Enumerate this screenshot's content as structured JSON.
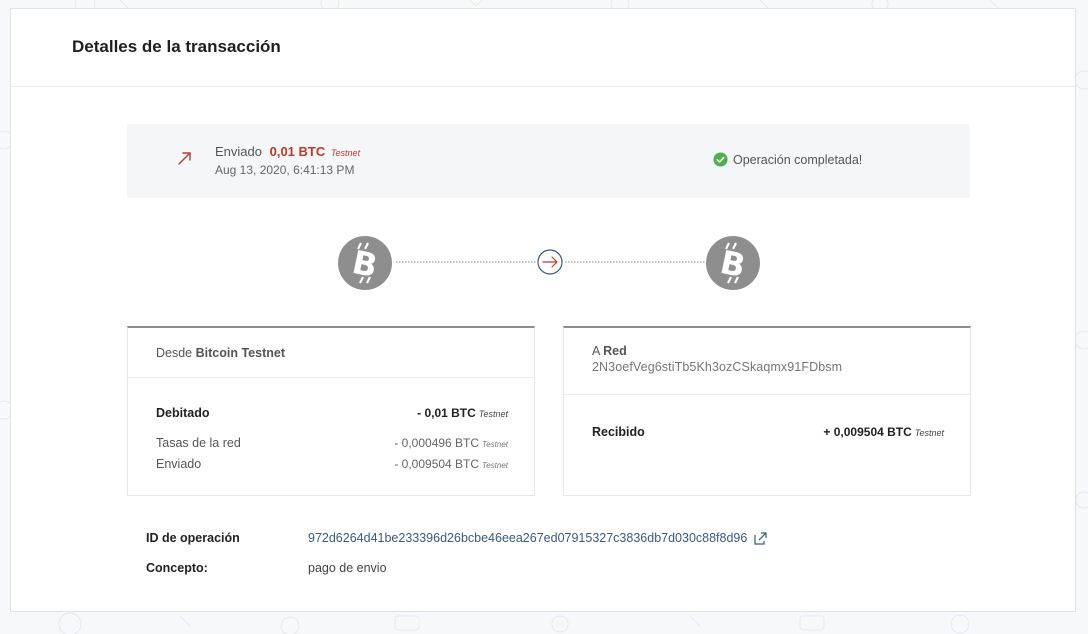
{
  "panel": {
    "title": "Detalles de la transacción"
  },
  "summary": {
    "direction": "Enviado",
    "amount": "0,01 BTC",
    "network": "Testnet",
    "date": "Aug 13, 2020, 6:41:13 PM",
    "status": "Operación completada!"
  },
  "from_card": {
    "prefix": "Desde",
    "name": "Bitcoin Testnet",
    "rows": [
      {
        "label": "Debitado",
        "value": "- 0,01 BTC",
        "net": "Testnet"
      },
      {
        "label": "Tasas de la red",
        "value": "- 0,000496 BTC",
        "net": "Testnet"
      },
      {
        "label": "Enviado",
        "value": "- 0,009504 BTC",
        "net": "Testnet"
      }
    ]
  },
  "to_card": {
    "prefix": "A",
    "name": "Red",
    "address": "2N3oefVeg6stiTb5Kh3ozCSkaqmx91FDbsm",
    "rows": [
      {
        "label": "Recibido",
        "value": "+ 0,009504 BTC",
        "net": "Testnet"
      }
    ]
  },
  "details": {
    "id_label": "ID de operación",
    "id_value": "972d6264d41be233396d26bcbe46eea267ed07915327c3836db7d030c88f8d96",
    "concept_label": "Concepto:",
    "concept_value": "pago de envio"
  },
  "colors": {
    "sent": "#c0392b",
    "success": "#4caf50",
    "bitcoin_badge": "#8e8e8e",
    "link": "#3d5a80"
  },
  "icons": {
    "sent": "arrow-up-right-icon",
    "status": "check-circle-icon",
    "coin": "bitcoin-icon",
    "transfer": "arrow-right-circle-icon",
    "external": "external-link-icon"
  }
}
